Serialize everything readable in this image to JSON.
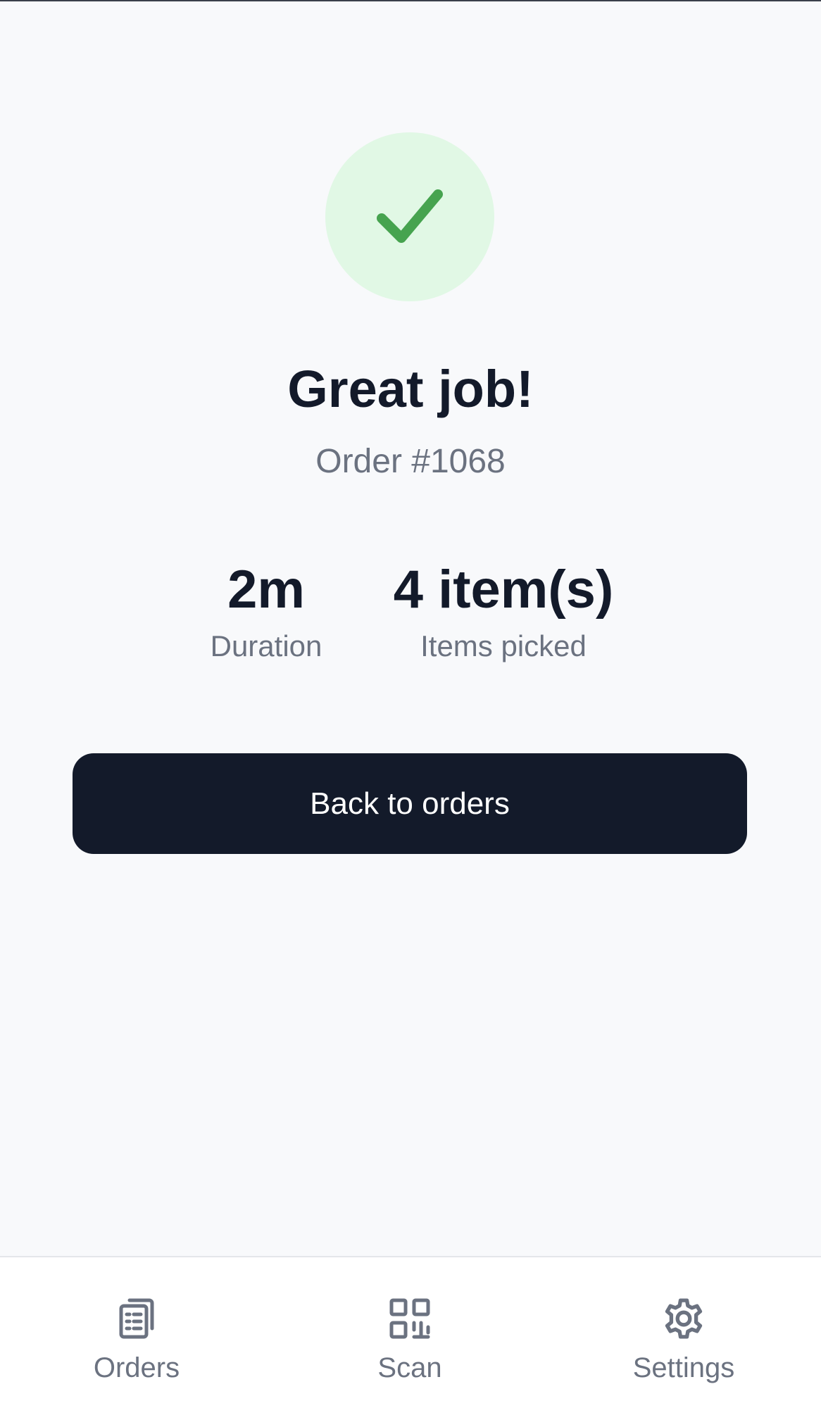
{
  "success": {
    "icon": "checkmark-icon",
    "title": "Great job!",
    "order_label": "Order #1068"
  },
  "stats": {
    "duration": {
      "value": "2m",
      "label": "Duration"
    },
    "items": {
      "value": "4 item(s)",
      "label": "Items picked"
    }
  },
  "actions": {
    "back_label": "Back to orders"
  },
  "nav": {
    "items": [
      {
        "label": "Orders",
        "icon": "clipboard-list-icon"
      },
      {
        "label": "Scan",
        "icon": "qr-code-icon"
      },
      {
        "label": "Settings",
        "icon": "gear-icon"
      }
    ]
  },
  "colors": {
    "success_bg": "#e1f8e5",
    "success_check": "#46a34f",
    "primary": "#131a2a",
    "muted_text": "#6b7280",
    "background": "#f8f9fb"
  }
}
